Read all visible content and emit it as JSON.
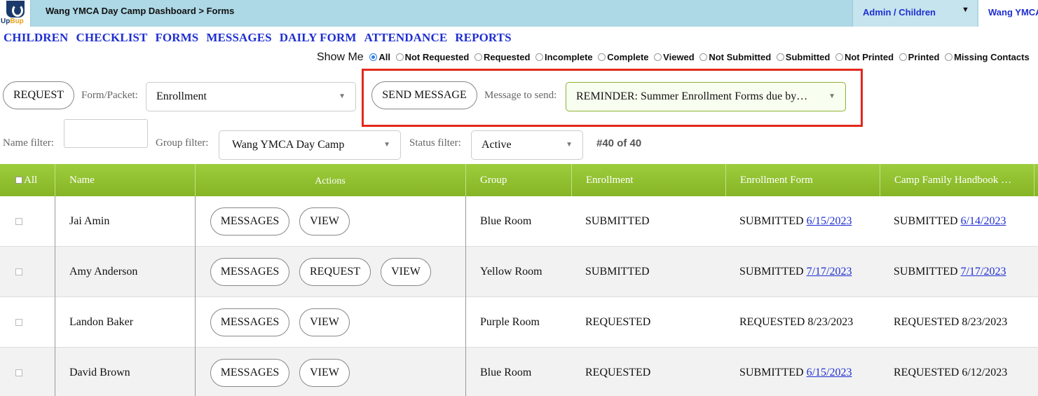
{
  "header": {
    "logo_text_up": "Up",
    "logo_text_bup": "Bup",
    "breadcrumb": "Wang YMCA Day Camp Dashboard > Forms",
    "admin_select": "Admin / Children",
    "site_tab": "Wang YMCA"
  },
  "nav": [
    "CHILDREN",
    "CHECKLIST",
    "FORMS",
    "MESSAGES",
    "DAILY FORM",
    "ATTENDANCE",
    "REPORTS"
  ],
  "show_me": {
    "title": "Show Me",
    "selected": "All",
    "options": [
      "All",
      "Not Requested",
      "Requested",
      "Incomplete",
      "Complete",
      "Viewed",
      "Not Submitted",
      "Submitted",
      "Not Printed",
      "Printed",
      "Missing Contacts"
    ]
  },
  "toolbar": {
    "request_label": "REQUEST",
    "form_packet_label": "Form/Packet:",
    "form_packet_value": "Enrollment",
    "send_message_label": "SEND MESSAGE",
    "message_label": "Message to send:",
    "message_value": "REMINDER: Summer Enrollment Forms due by…"
  },
  "filters": {
    "name_label": "Name filter:",
    "name_value": "",
    "group_label": "Group filter:",
    "group_value": "Wang YMCA Day Camp",
    "status_label": "Status filter:",
    "status_value": "Active",
    "count": "#40 of 40"
  },
  "table": {
    "all_label": "All",
    "columns": [
      "Name",
      "Actions",
      "Group",
      "Enrollment",
      "Enrollment Form",
      "Camp Family Handbook …"
    ],
    "rows": [
      {
        "name": "Jai Amin",
        "actions": [
          "MESSAGES",
          "VIEW"
        ],
        "group": "Blue Room",
        "enrollment": "SUBMITTED",
        "form_status": "SUBMITTED",
        "form_date": "6/15/2023",
        "form_link": true,
        "handbook_status": "SUBMITTED",
        "handbook_date": "6/14/2023",
        "handbook_link": true
      },
      {
        "name": "Amy Anderson",
        "actions": [
          "MESSAGES",
          "REQUEST",
          "VIEW"
        ],
        "group": "Yellow Room",
        "enrollment": "SUBMITTED",
        "form_status": "SUBMITTED",
        "form_date": "7/17/2023",
        "form_link": true,
        "handbook_status": "SUBMITTED",
        "handbook_date": "7/17/2023",
        "handbook_link": true
      },
      {
        "name": "Landon Baker",
        "actions": [
          "MESSAGES",
          "VIEW"
        ],
        "group": "Purple Room",
        "enrollment": "REQUESTED",
        "form_status": "REQUESTED",
        "form_date": "8/23/2023",
        "form_link": false,
        "handbook_status": "REQUESTED",
        "handbook_date": "8/23/2023",
        "handbook_link": false
      },
      {
        "name": "David Brown",
        "actions": [
          "MESSAGES",
          "VIEW"
        ],
        "group": "Blue Room",
        "enrollment": "REQUESTED",
        "form_status": "SUBMITTED",
        "form_date": "6/15/2023",
        "form_link": true,
        "handbook_status": "REQUESTED",
        "handbook_date": "6/12/2023",
        "handbook_link": false
      }
    ]
  },
  "colors": {
    "topbar": "#add8e6",
    "nav_link": "#1f2fd1",
    "table_header": "#8fbe2c",
    "highlight_box": "#e3281c"
  }
}
